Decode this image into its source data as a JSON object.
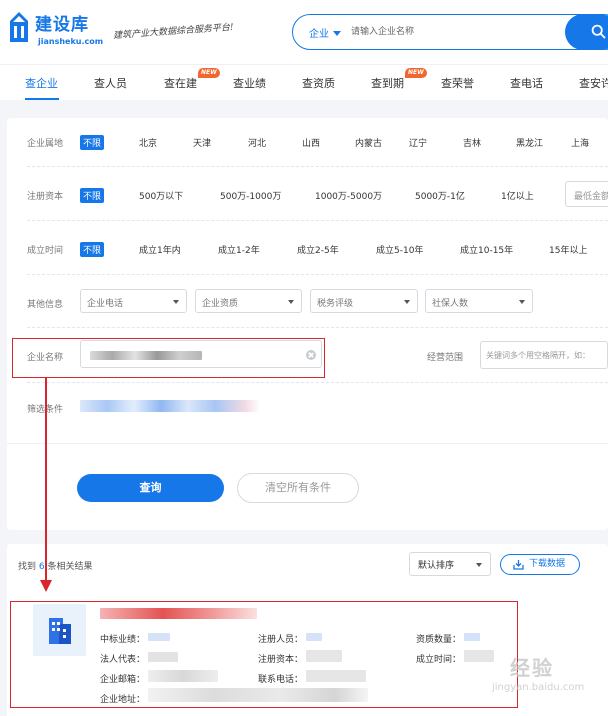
{
  "header": {
    "logo_name": "建设库",
    "logo_domain": "jiansheku.com",
    "slogan": "建筑产业大数据综合服务平台!",
    "search": {
      "type_label": "企业",
      "placeholder": "请输入企业名称"
    }
  },
  "tabs": [
    {
      "label": "查企业",
      "new": ""
    },
    {
      "label": "查人员",
      "new": ""
    },
    {
      "label": "查在建",
      "new": "NEW"
    },
    {
      "label": "查业绩",
      "new": ""
    },
    {
      "label": "查资质",
      "new": ""
    },
    {
      "label": "查到期",
      "new": "NEW"
    },
    {
      "label": "查荣誉",
      "new": ""
    },
    {
      "label": "查电话",
      "new": ""
    },
    {
      "label": "查安许",
      "new": ""
    }
  ],
  "filters": {
    "region": {
      "label": "企业属地",
      "options": [
        "不限",
        "北京",
        "天津",
        "河北",
        "山西",
        "内蒙古",
        "辽宁",
        "吉林",
        "黑龙江",
        "上海"
      ]
    },
    "capital": {
      "label": "注册资本",
      "options": [
        "不限",
        "500万以下",
        "500万-1000万",
        "1000万-5000万",
        "5000万-1亿",
        "1亿以上"
      ],
      "min_placeholder": "最低金额"
    },
    "founded": {
      "label": "成立时间",
      "options": [
        "不限",
        "成立1年内",
        "成立1-2年",
        "成立2-5年",
        "成立5-10年",
        "成立10-15年",
        "15年以上"
      ]
    },
    "other": {
      "label": "其他信息",
      "dropdowns": [
        "企业电话",
        "企业资质",
        "税务评级",
        "社保人数"
      ]
    },
    "company_name": {
      "label": "企业名称"
    },
    "business_scope": {
      "label": "经营范围",
      "placeholder": "关键词多个用空格隔开，如："
    },
    "conditions": {
      "label": "筛选条件"
    }
  },
  "actions": {
    "query": "查询",
    "clear": "清空所有条件"
  },
  "results": {
    "found_prefix": "找到",
    "found_count": "6",
    "found_suffix": "条相关结果",
    "sort_label": "默认排序",
    "download_label": "下载数据",
    "fields": {
      "bid_performance": "中标业绩：",
      "legal_rep": "法人代表：",
      "email": "企业邮箱：",
      "address": "企业地址：",
      "registered_staff": "注册人员：",
      "registered_capital": "注册资本：",
      "phone": "联系电话：",
      "qualification_count": "资质数量：",
      "founded_time": "成立时间："
    }
  },
  "watermark": {
    "text": "经验",
    "sub": "jingyan.baidu.com"
  },
  "colors": {
    "brand": "#1677e8",
    "annotation": "#d8262c",
    "new_badge": "#f2662f"
  },
  "icons": [
    "search-icon",
    "download-icon",
    "building-icon",
    "clear-icon",
    "caret-down-icon"
  ]
}
